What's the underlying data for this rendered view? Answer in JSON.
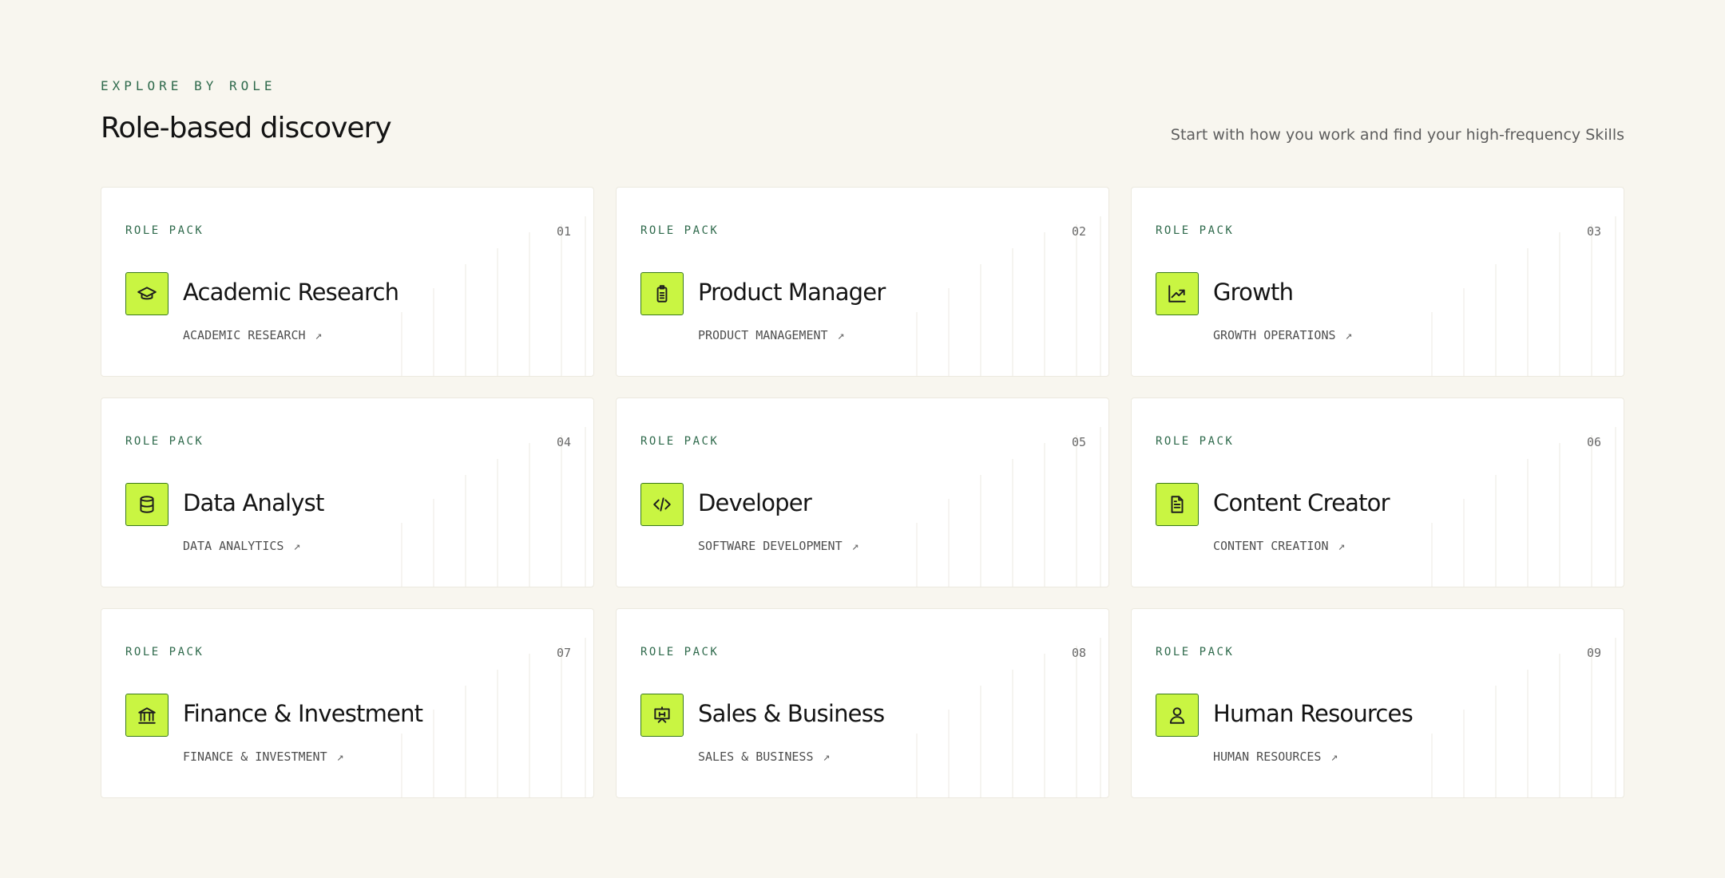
{
  "header": {
    "eyebrow": "EXPLORE BY ROLE",
    "title": "Role-based discovery",
    "subtitle": "Start with how you work and find your high-frequency Skills"
  },
  "colors": {
    "background": "#f8f6ef",
    "accent": "#c9f542",
    "accent_border": "#3a7a1c",
    "tag_green": "#2f6a4c"
  },
  "cards": [
    {
      "tag": "ROLE PACK",
      "number": "01",
      "icon": "graduation-cap-icon",
      "title": "Academic Research",
      "subtitle": "ACADEMIC RESEARCH",
      "arrow": "↗"
    },
    {
      "tag": "ROLE PACK",
      "number": "02",
      "icon": "clipboard-icon",
      "title": "Product Manager",
      "subtitle": "PRODUCT MANAGEMENT",
      "arrow": "↗"
    },
    {
      "tag": "ROLE PACK",
      "number": "03",
      "icon": "line-chart-icon",
      "title": "Growth",
      "subtitle": "GROWTH OPERATIONS",
      "arrow": "↗"
    },
    {
      "tag": "ROLE PACK",
      "number": "04",
      "icon": "database-icon",
      "title": "Data Analyst",
      "subtitle": "DATA ANALYTICS",
      "arrow": "↗"
    },
    {
      "tag": "ROLE PACK",
      "number": "05",
      "icon": "code-icon",
      "title": "Developer",
      "subtitle": "SOFTWARE DEVELOPMENT",
      "arrow": "↗"
    },
    {
      "tag": "ROLE PACK",
      "number": "06",
      "icon": "document-icon",
      "title": "Content Creator",
      "subtitle": "CONTENT CREATION",
      "arrow": "↗"
    },
    {
      "tag": "ROLE PACK",
      "number": "07",
      "icon": "bank-icon",
      "title": "Finance & Investment",
      "subtitle": "FINANCE & INVESTMENT",
      "arrow": "↗"
    },
    {
      "tag": "ROLE PACK",
      "number": "08",
      "icon": "presentation-board-icon",
      "title": "Sales & Business",
      "subtitle": "SALES & BUSINESS",
      "arrow": "↗"
    },
    {
      "tag": "ROLE PACK",
      "number": "09",
      "icon": "user-icon",
      "title": "Human Resources",
      "subtitle": "HUMAN RESOURCES",
      "arrow": "↗"
    }
  ]
}
